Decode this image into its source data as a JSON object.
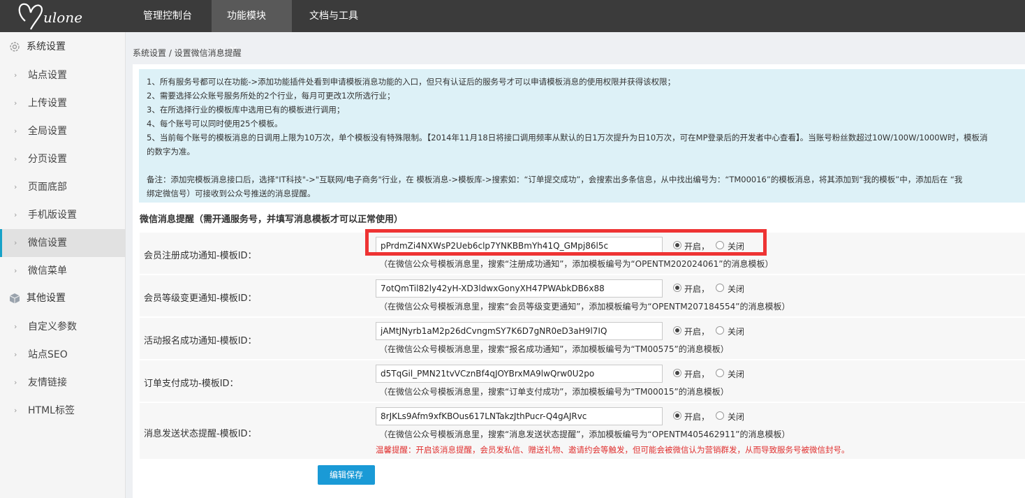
{
  "topbar": {
    "logo_text": "Mulone",
    "nav": [
      {
        "label": "管理控制台"
      },
      {
        "label": "功能模块"
      },
      {
        "label": "文档与工具"
      }
    ]
  },
  "sidebar": {
    "group1": "系统设置",
    "items1": [
      "站点设置",
      "上传设置",
      "全局设置",
      "分页设置",
      "页面底部",
      "手机版设置",
      "微信设置",
      "微信菜单"
    ],
    "group2": "其他设置",
    "items2": [
      "自定义参数",
      "站点SEO",
      "友情链接",
      "HTML标签"
    ],
    "active": "微信设置"
  },
  "breadcrumb": "系统设置 / 设置微信消息提醒",
  "notice": {
    "lines": [
      "1、所有服务号都可以在功能->添加功能插件处看到申请模板消息功能的入口，但只有认证后的服务号才可以申请模板消息的使用权限并获得该权限；",
      "2、需要选择公众账号服务所处的2个行业，每月可更改1次所选行业；",
      "3、在所选择行业的模板库中选用已有的模板进行调用；",
      "4、每个账号可以同时使用25个模板。",
      "5、当前每个账号的模板消息的日调用上限为10万次，单个模板没有特殊限制。【2014年11月18日将接口调用频率从默认的日1万次提升为日10万次，可在MP登录后的开发者中心查看】。当账号粉丝数超过10W/100W/1000W时，模板消",
      "的数字为准。",
      "备注：添加完模板消息接口后，选择\"IT科技\"->\"互联网/电子商务\"行业，在 模板消息->模板库->搜索如：“订单提交成功”，会搜索出多条信息，从中找出编号为：“TM00016”的模板消息，将其添加到“我的模板”中，添加后在 “我",
      "绑定微信号）可接收到公众号推送的消息提醒。"
    ]
  },
  "section_title": "微信消息提醒（需开通服务号，并填写消息模板才可以正常使用）",
  "radio_on": "开启，",
  "radio_off": "关闭",
  "rows": [
    {
      "label": "会员注册成功通知-模板ID：",
      "value": "pPrdmZi4NXWsP2Ueb6clp7YNKBBmYh41Q_GMpj86l5c",
      "hint": "（在微信公众号模板消息里，搜索“注册成功通知”，添加模板编号为“OPENTM202024061”的消息模板）"
    },
    {
      "label": "会员等级变更通知-模板ID：",
      "value": "7otQmTil82ly42yH-XD3ldwxGonyXH47PWAbkDB6x88",
      "hint": "（在微信公众号模板消息里，搜索“会员等级变更通知”，添加模板编号为“OPENTM207184554”的消息模板）"
    },
    {
      "label": "活动报名成功通知-模板ID：",
      "value": "jAMtJNyrb1aM2p26dCvngmSY7K6D7gNR0eD3aH9l7IQ",
      "hint": "（在微信公众号模板消息里，搜索“报名成功通知”，添加模板编号为“TM00575”的消息模板）"
    },
    {
      "label": "订单支付成功-模板ID：",
      "value": "d5TqGil_PMN21tvVCznBf4qJOYBrxMA9lwQrw0U2po",
      "hint": "（在微信公众号模板消息里，搜索“订单支付成功”，添加模板编号为“TM00015”的消息模板）"
    },
    {
      "label": "消息发送状态提醒-模板ID：",
      "value": "8rJKLs9Afm9xfKBOus617LNTakzJthPucr-Q4gAJRvc",
      "hint": "（在微信公众号模板消息里，搜索“消息发送状态提醒”，添加模板编号为“OPENTM405462911”的消息模板）"
    }
  ],
  "warning": "温馨提醒：开启该消息提醒，会员发私信、赠送礼物、邀请约会等触发，但可能会被微信认为营销群发，从而导致服务号被微信封号。",
  "save_label": "编辑保存",
  "colors": {
    "accent": "#1a9ad6",
    "highlight": "#e33333",
    "warning": "#e0302f"
  }
}
